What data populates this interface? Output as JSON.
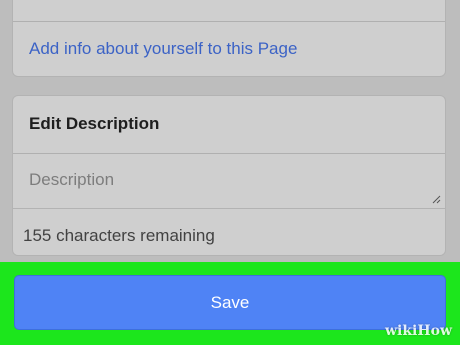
{
  "about": {
    "link_text": "Add info about yourself to this Page"
  },
  "description": {
    "header": "Edit Description",
    "placeholder": "Description",
    "remaining_text": "155 characters remaining"
  },
  "actions": {
    "save_label": "Save"
  },
  "watermark": {
    "text": "wikiHow"
  },
  "colors": {
    "accent": "#4f83f5",
    "highlight": "#1ce61c",
    "link": "#3c63c6"
  }
}
